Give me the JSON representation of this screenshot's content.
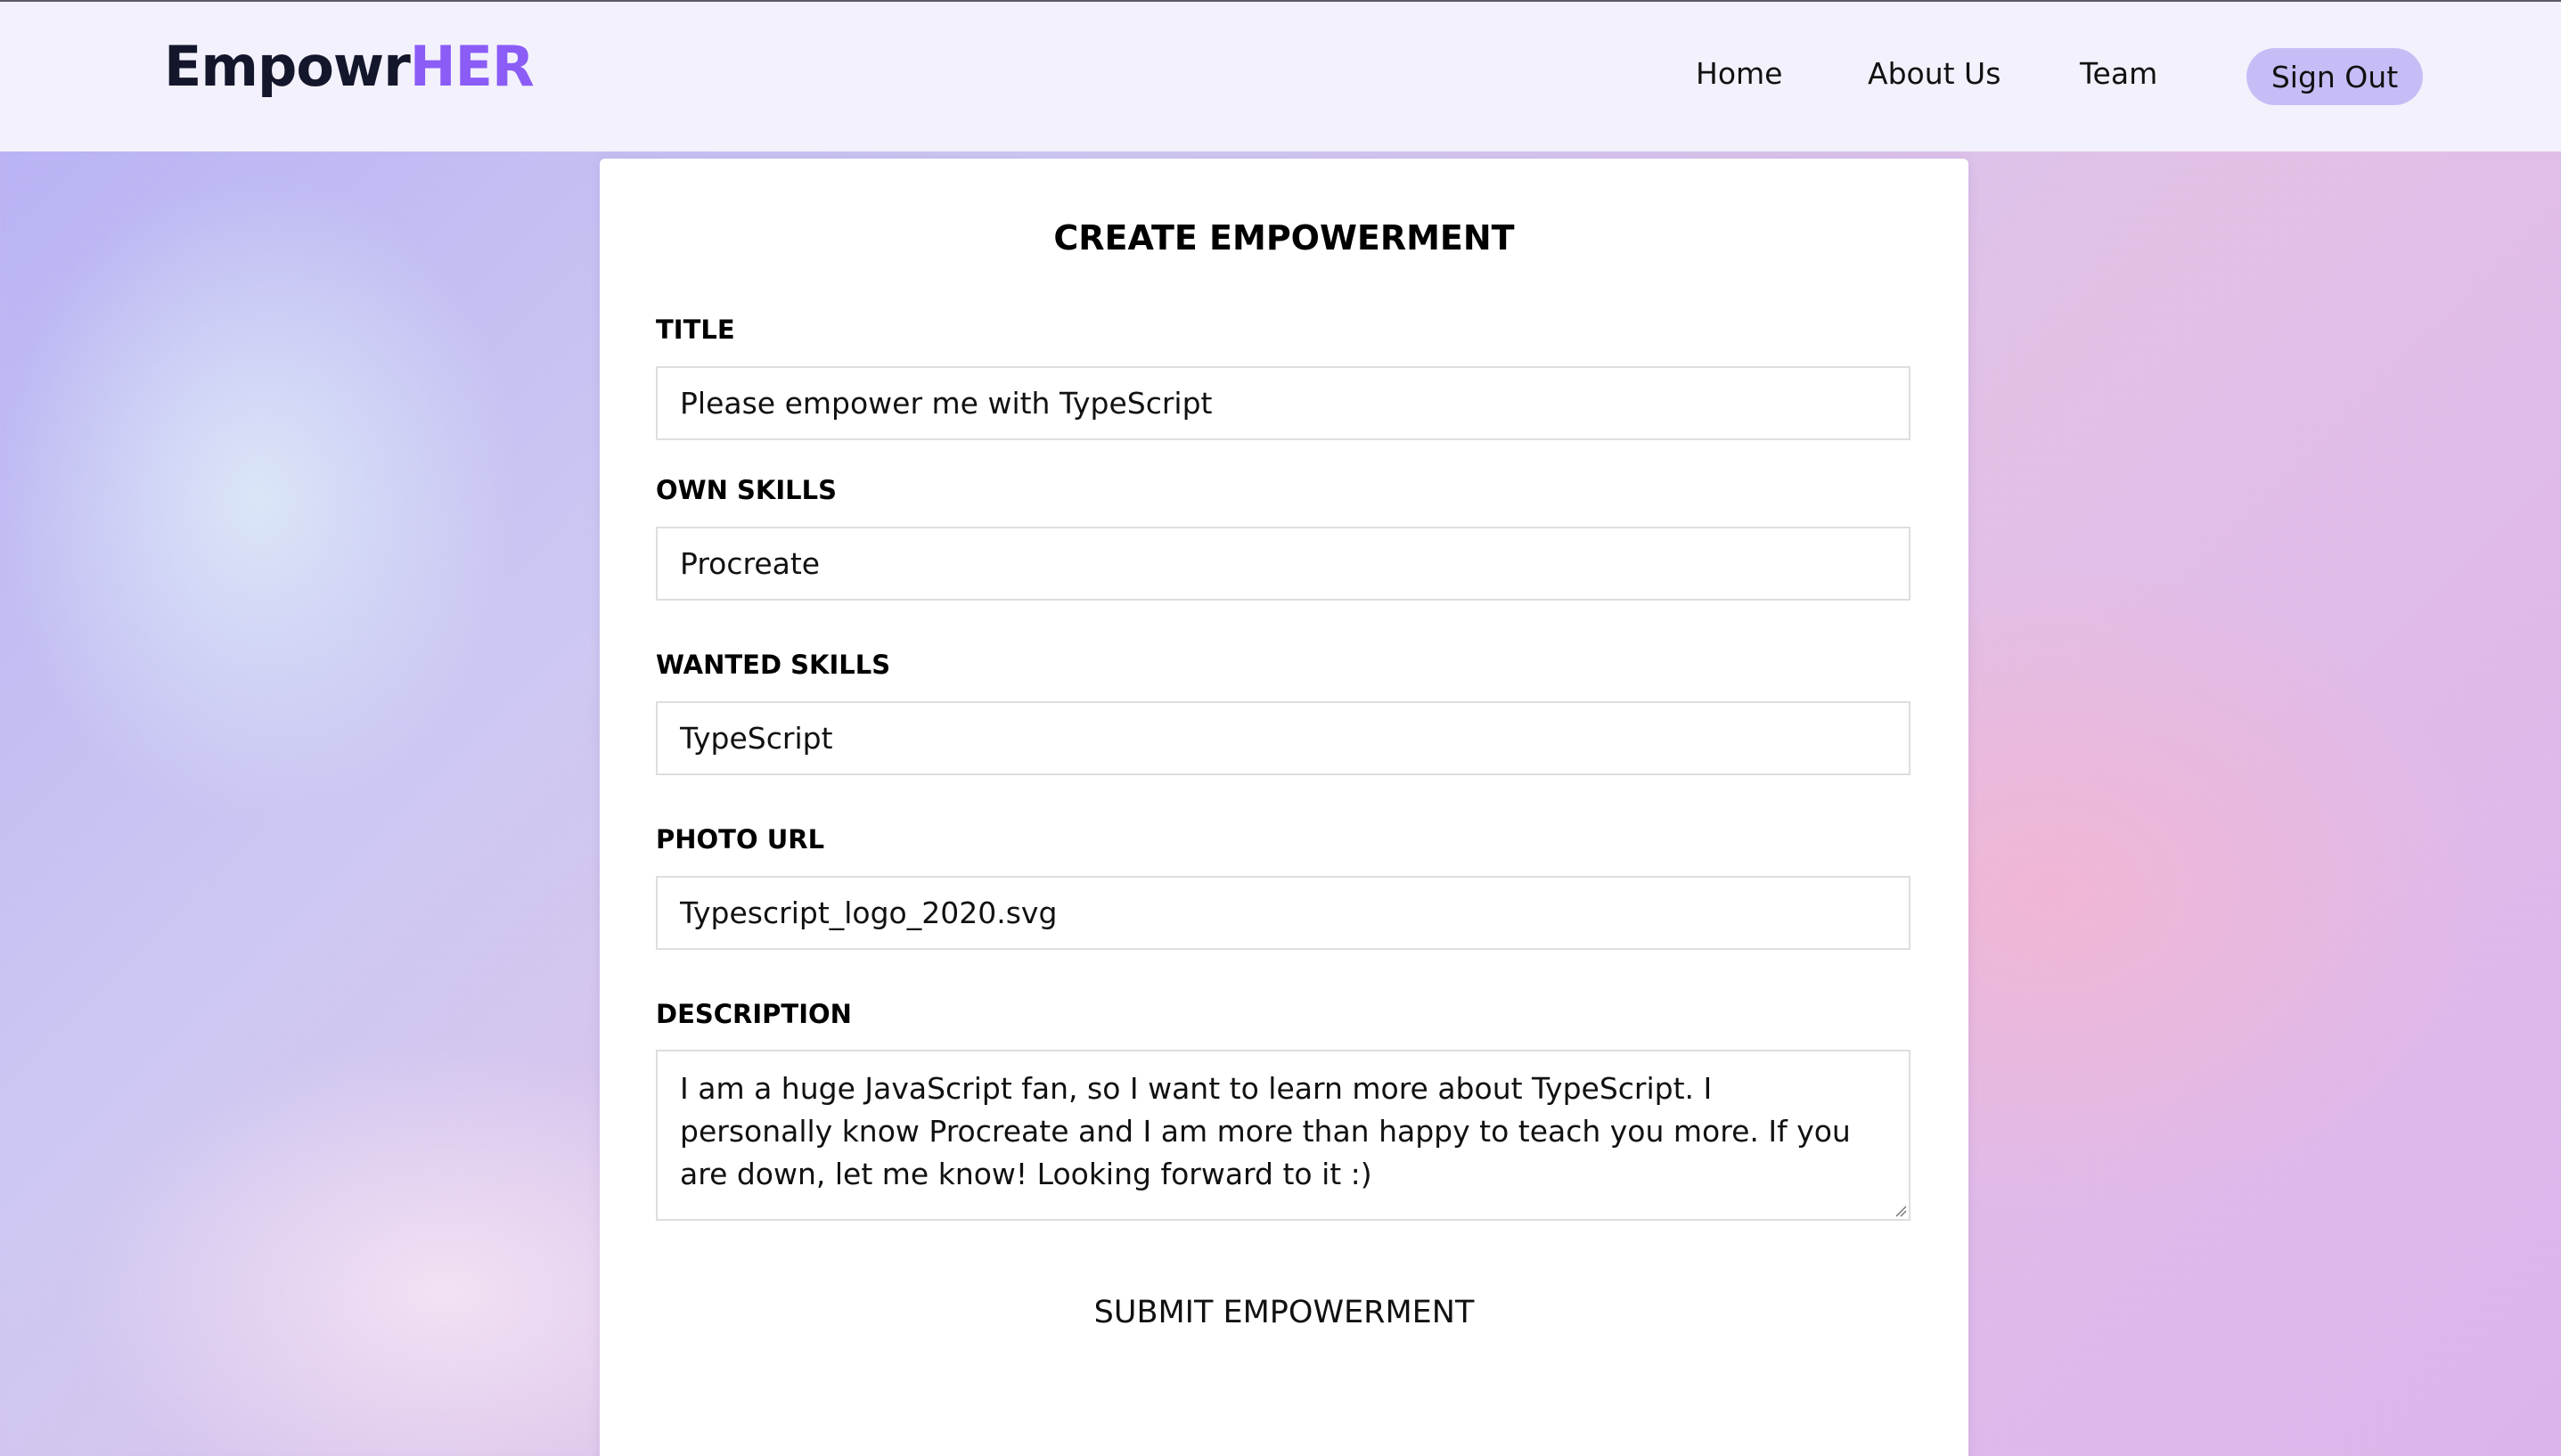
{
  "app": {
    "logo_main": "Empowr",
    "logo_accent": "HER"
  },
  "nav": {
    "home": "Home",
    "about": "About Us",
    "team": "Team",
    "sign_out": "Sign Out"
  },
  "form": {
    "title": "CREATE EMPOWERMENT",
    "fields": {
      "title": {
        "label": "TITLE",
        "value": "Please empower me with TypeScript"
      },
      "own_skills": {
        "label": "OWN SKILLS",
        "value": "Procreate"
      },
      "wanted_skills": {
        "label": "WANTED SKILLS",
        "value": "TypeScript"
      },
      "photo_url": {
        "label": "PHOTO URL",
        "value": "Typescript_logo_2020.svg"
      },
      "description": {
        "label": "DESCRIPTION",
        "value": "I am a huge JavaScript fan, so I want to learn more about TypeScript. I personally know Procreate and I am more than happy to teach you more. If you are down, let me know! Looking forward to it :)"
      }
    },
    "submit_label": "SUBMIT EMPOWERMENT"
  },
  "colors": {
    "logo_accent": "#8b5cf6",
    "sign_out_bg": "#c7bdf6",
    "navbar_bg": "#f3f1fc"
  }
}
